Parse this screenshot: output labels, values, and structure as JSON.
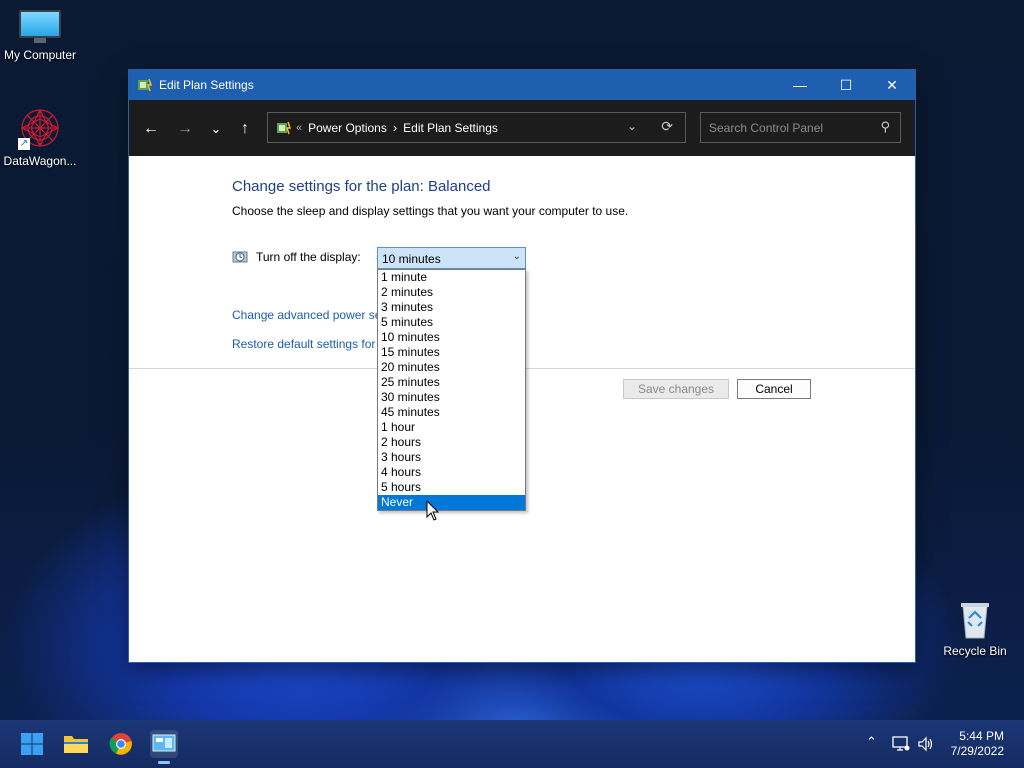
{
  "desktop": {
    "icons": [
      {
        "label": "My Computer"
      },
      {
        "label": "DataWagon..."
      },
      {
        "label": "Recycle Bin"
      }
    ]
  },
  "window": {
    "title": "Edit Plan Settings",
    "controls": {
      "minimize": "—",
      "maximize": "☐",
      "close": "✕"
    }
  },
  "navbar": {
    "back": "←",
    "forward": "→",
    "recent": "⌄",
    "up": "↑",
    "breadcrumb": {
      "prefix": "«",
      "items": [
        "Power Options",
        "Edit Plan Settings"
      ],
      "separator": "›"
    },
    "address_dropdown": "⌄",
    "refresh": "⟳",
    "search_placeholder": "Search Control Panel",
    "search_icon": "⚲"
  },
  "content": {
    "heading": "Change settings for the plan: Balanced",
    "subheading": "Choose the sleep and display settings that you want your computer to use.",
    "display_label": "Turn off the display:",
    "display_value": "10 minutes",
    "dropdown_arrow": "⌄",
    "options": [
      "1 minute",
      "2 minutes",
      "3 minutes",
      "5 minutes",
      "10 minutes",
      "15 minutes",
      "20 minutes",
      "25 minutes",
      "30 minutes",
      "45 minutes",
      "1 hour",
      "2 hours",
      "3 hours",
      "4 hours",
      "5 hours",
      "Never"
    ],
    "highlighted_option": "Never",
    "link_advanced": "Change advanced power se",
    "link_restore": "Restore default settings for t",
    "save_label": "Save changes",
    "cancel_label": "Cancel"
  },
  "taskbar": {
    "time": "5:44 PM",
    "date": "7/29/2022",
    "tray_chevron": "⌃"
  },
  "colors": {
    "titlebar": "#1f5fb0",
    "navbar": "#1c1c1c",
    "heading": "#1e3f8a",
    "link": "#1a5ea8",
    "selection": "#0078d7"
  }
}
